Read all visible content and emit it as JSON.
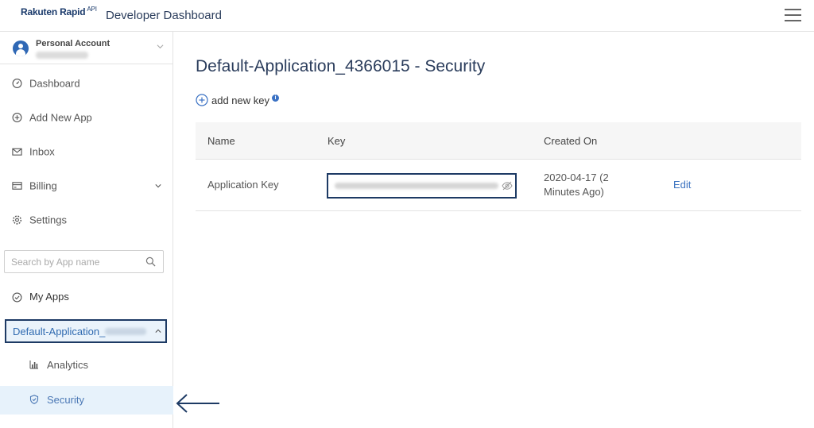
{
  "header": {
    "brand": "Rakuten Rapid",
    "brand_suffix": "API",
    "title": "Developer Dashboard",
    "menu_icon": "hamburger-menu-icon"
  },
  "account": {
    "name": "Personal Account",
    "avatar_icon": "user-avatar-icon",
    "chevron_icon": "chevron-down-icon"
  },
  "sidebar": {
    "items": [
      {
        "label": "Dashboard",
        "icon": "dashboard-icon"
      },
      {
        "label": "Add New App",
        "icon": "plus-circle-icon"
      },
      {
        "label": "Inbox",
        "icon": "mail-icon"
      },
      {
        "label": "Billing",
        "icon": "billing-icon"
      },
      {
        "label": "Settings",
        "icon": "gear-icon"
      }
    ],
    "search": {
      "placeholder": "Search by App name",
      "icon": "search-icon"
    },
    "my_apps": {
      "label": "My Apps",
      "icon": "check-circle-icon"
    },
    "app_select": {
      "label": "Default-Application_"
    },
    "sub_items": [
      {
        "label": "Analytics",
        "icon": "bar-chart-icon"
      },
      {
        "label": "Security",
        "icon": "shield-icon"
      }
    ]
  },
  "main": {
    "title": "Default-Application_4366015 - Security",
    "add_key_label": "add new key",
    "info_icon": "i",
    "table": {
      "headers": [
        "Name",
        "Key",
        "Created On"
      ],
      "rows": [
        {
          "name": "Application Key",
          "created_on": "2020-04-17 (2 Minutes Ago)",
          "action": "Edit"
        }
      ]
    }
  },
  "colors": {
    "brand": "#1a3a6b",
    "highlight_border": "#1d3a64",
    "link": "#3a72c0",
    "active_bg": "#e7f2fb"
  }
}
